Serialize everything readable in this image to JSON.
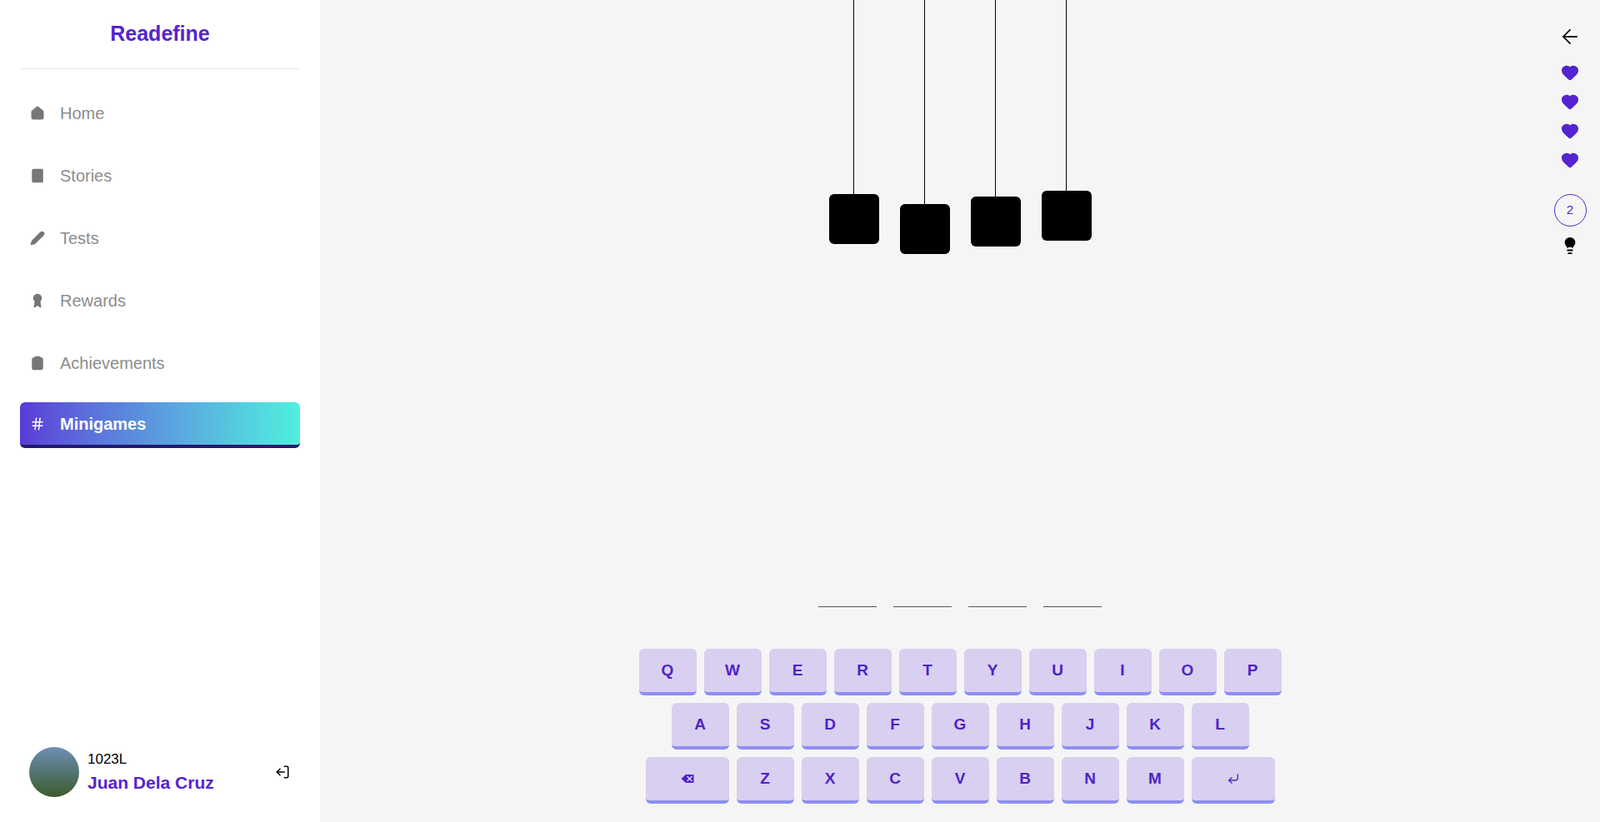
{
  "sidebar": {
    "logo": "Readefine",
    "items": [
      {
        "label": "Home",
        "selected": false
      },
      {
        "label": "Stories",
        "selected": false
      },
      {
        "label": "Tests",
        "selected": false
      },
      {
        "label": "Rewards",
        "selected": false
      },
      {
        "label": "Achievements",
        "selected": false
      },
      {
        "label": "Minigames",
        "selected": true
      }
    ],
    "user": {
      "level": "1023L",
      "name": "Juan Dela Cruz"
    }
  },
  "game": {
    "hanging_blocks": [
      {
        "revealed": false
      },
      {
        "revealed": false
      },
      {
        "revealed": false
      },
      {
        "revealed": false
      }
    ],
    "blanks": [
      {
        "letter": ""
      },
      {
        "letter": ""
      },
      {
        "letter": ""
      },
      {
        "letter": ""
      }
    ],
    "lives": [
      {
        "filled": true
      },
      {
        "filled": true
      },
      {
        "filled": true
      },
      {
        "filled": true
      }
    ],
    "hints": "2",
    "keyboard": [
      [
        {
          "kind": "letter",
          "label": "Q"
        },
        {
          "kind": "letter",
          "label": "W"
        },
        {
          "kind": "letter",
          "label": "E"
        },
        {
          "kind": "letter",
          "label": "R"
        },
        {
          "kind": "letter",
          "label": "T"
        },
        {
          "kind": "letter",
          "label": "Y"
        },
        {
          "kind": "letter",
          "label": "U"
        },
        {
          "kind": "letter",
          "label": "I"
        },
        {
          "kind": "letter",
          "label": "O"
        },
        {
          "kind": "letter",
          "label": "P"
        }
      ],
      [
        {
          "kind": "letter",
          "label": "A"
        },
        {
          "kind": "letter",
          "label": "S"
        },
        {
          "kind": "letter",
          "label": "D"
        },
        {
          "kind": "letter",
          "label": "F"
        },
        {
          "kind": "letter",
          "label": "G"
        },
        {
          "kind": "letter",
          "label": "H"
        },
        {
          "kind": "letter",
          "label": "J"
        },
        {
          "kind": "letter",
          "label": "K"
        },
        {
          "kind": "letter",
          "label": "L"
        }
      ],
      [
        {
          "kind": "backspace",
          "label": ""
        },
        {
          "kind": "letter",
          "label": "Z"
        },
        {
          "kind": "letter",
          "label": "X"
        },
        {
          "kind": "letter",
          "label": "C"
        },
        {
          "kind": "letter",
          "label": "V"
        },
        {
          "kind": "letter",
          "label": "B"
        },
        {
          "kind": "letter",
          "label": "N"
        },
        {
          "kind": "letter",
          "label": "M"
        },
        {
          "kind": "enter",
          "label": ""
        }
      ]
    ]
  }
}
